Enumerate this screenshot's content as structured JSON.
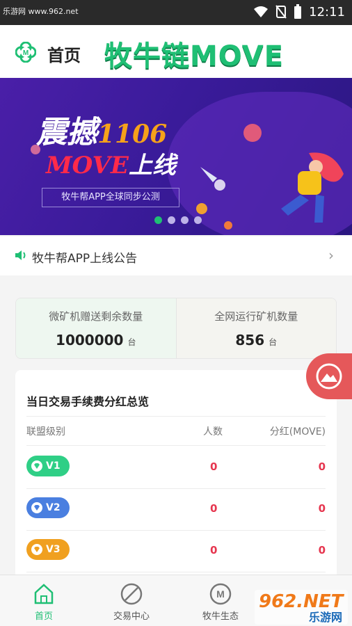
{
  "statusbar": {
    "watermark": "乐游网 www.962.net",
    "time": "12:11"
  },
  "header": {
    "home_title": "首页",
    "brand": "牧牛链MOVE"
  },
  "banner": {
    "line1_cn": "震撼",
    "line1_num": "1106",
    "line2_en": "MOVE",
    "line2_cn": "上线",
    "subtitle": "牧牛帮APP全球同步公测",
    "slides": 4,
    "active_slide": 0
  },
  "notice": {
    "text": "牧牛帮APP上线公告"
  },
  "stats": [
    {
      "label": "微矿机赠送剩余数量",
      "value": "1000000",
      "unit": "台"
    },
    {
      "label": "全网运行矿机数量",
      "value": "856",
      "unit": "台"
    }
  ],
  "dividend": {
    "title": "当日交易手续费分红总览",
    "columns": [
      "联盟级别",
      "人数",
      "分红(MOVE)"
    ],
    "rows": [
      {
        "level": "V1",
        "color": "#2fcf86",
        "count": "0",
        "dividend": "0"
      },
      {
        "level": "V2",
        "color": "#4a7fe0",
        "count": "0",
        "dividend": "0"
      },
      {
        "level": "V3",
        "color": "#f0a020",
        "count": "0",
        "dividend": "0"
      }
    ]
  },
  "tabs": [
    {
      "label": "首页",
      "icon": "home-icon",
      "active": true
    },
    {
      "label": "交易中心",
      "icon": "trade-icon",
      "active": false
    },
    {
      "label": "牧牛生态",
      "icon": "ecosystem-icon",
      "active": false
    }
  ],
  "watermark2": {
    "a": "962.NET",
    "b": "乐游网"
  },
  "colors": {
    "brand": "#1fbf74",
    "accent_red": "#e6364f"
  }
}
